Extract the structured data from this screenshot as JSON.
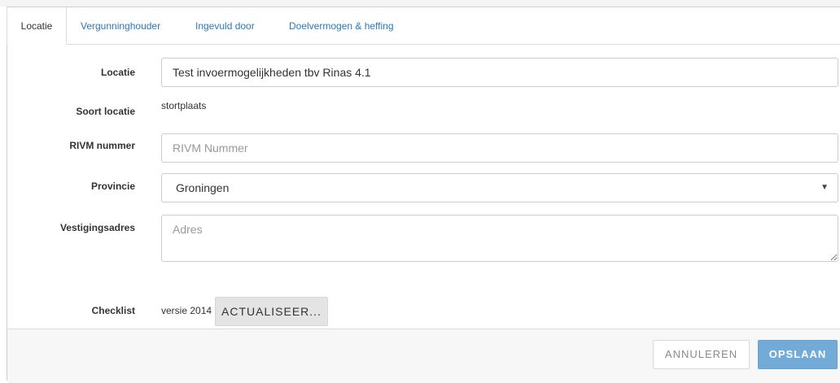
{
  "tabs": [
    {
      "label": "Locatie",
      "active": true
    },
    {
      "label": "Vergunninghouder",
      "active": false
    },
    {
      "label": "Ingevuld door",
      "active": false
    },
    {
      "label": "Doelvermogen & heffing",
      "active": false
    }
  ],
  "form": {
    "locatie": {
      "label": "Locatie",
      "value": "Test invoermogelijkheden tbv Rinas 4.1"
    },
    "soort_locatie": {
      "label": "Soort locatie",
      "value": "stortplaats"
    },
    "rivm_nummer": {
      "label": "RIVM nummer",
      "value": "",
      "placeholder": "RIVM Nummer"
    },
    "provincie": {
      "label": "Provincie",
      "selected": "Groningen",
      "icon": "caret-down-icon"
    },
    "vestigingsadres": {
      "label": "Vestigingsadres",
      "value": "",
      "placeholder": "Adres"
    },
    "checklist": {
      "label": "Checklist",
      "version": "versie 2014",
      "button_label": "ACTUALISEER..."
    }
  },
  "footer": {
    "cancel_label": "ANNULEREN",
    "save_label": "OPSLAAN"
  },
  "colors": {
    "link": "#2a7ab8",
    "primary_button": "#73abd8",
    "border": "#cccccc"
  }
}
